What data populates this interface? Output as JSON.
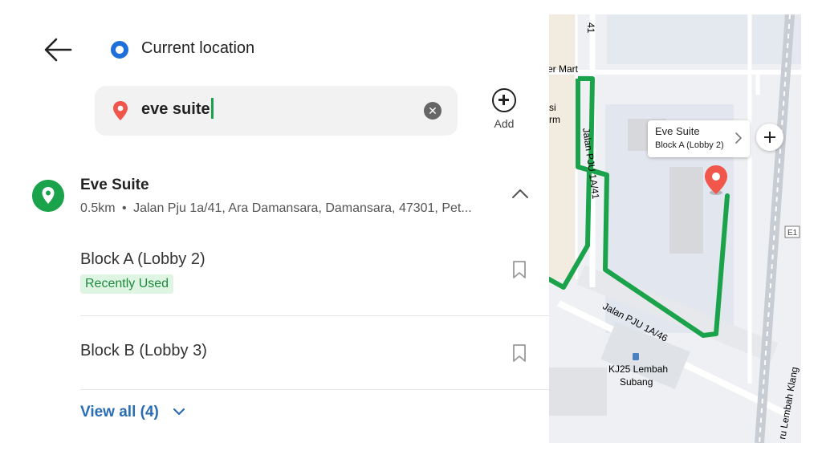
{
  "header": {
    "current_location_label": "Current location"
  },
  "search": {
    "value": "eve suite",
    "add_label": "Add"
  },
  "place": {
    "title": "Eve Suite",
    "distance": "0.5km",
    "separator": "•",
    "address": "Jalan Pju 1a/41, Ara Damansara, Damansara, 47301, Pet..."
  },
  "entrances": [
    {
      "name": "Block A (Lobby 2)",
      "badge": "Recently Used"
    },
    {
      "name": "Block B (Lobby 3)"
    }
  ],
  "view_all_label": "View all (4)",
  "map": {
    "callout_title": "Eve Suite",
    "callout_subtitle": "Block A (Lobby 2)",
    "labels": {
      "road_41": "41",
      "mart": "er Mart",
      "si": "si",
      "rm": "rm",
      "jalan_pju_1a_41": "Jalan PJU 1A/41",
      "jalan_pju_1a_46": "Jalan PJU 1A/46",
      "station_1": "KJ25 Lembah",
      "station_2": "Subang",
      "highway": "E1",
      "klang": "ru Lembah Klang"
    },
    "route_color": "#1aa34a",
    "pin_color": "#f0564a"
  },
  "colors": {
    "accent_green": "#1aa34a",
    "link_blue": "#2a6db5",
    "current_dot": "#1e6fd9"
  }
}
